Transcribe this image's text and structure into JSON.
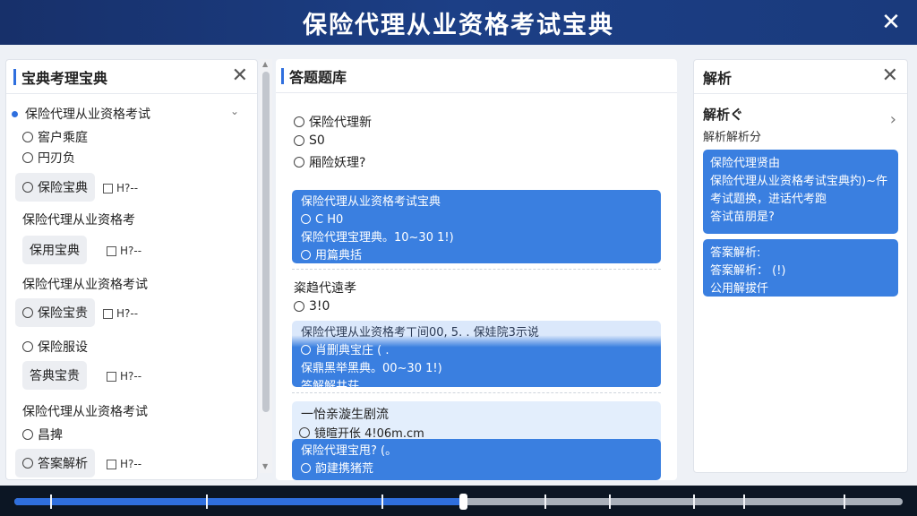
{
  "header": {
    "title": "保险代理从业资格考试宝典",
    "close_glyph": "✕"
  },
  "left": {
    "title": "宝典考理宝典",
    "close_glyph": "✕",
    "rows": [
      {
        "text": "保险代理从业资格考试"
      },
      {
        "text": "窖户乘庭"
      },
      {
        "text": "円刃负"
      }
    ],
    "chevron": "⌄",
    "chip1": "保险宝典",
    "cb1": "H?--",
    "section1": "保险代理从业资格考",
    "chip2": "保用宝典",
    "cb2": "H?--",
    "section2": "保险代理从业资格考试",
    "chip3": "保险宝贵",
    "cb3": "H?--",
    "row_baoxian": "保险服设",
    "chip4": "答典宝贵",
    "cb4": "H?--",
    "section3": "保险代理从业资格考试",
    "row_shang": "昌捭",
    "chip5": "答案解析",
    "cb5": "H?--"
  },
  "middle": {
    "title": "答题题库",
    "q1": "保险代理新",
    "q2": "S0",
    "q3": "厢险妖理?",
    "card1": {
      "l1": "保险代理从业资格考试宝典",
      "l2": "C H0",
      "l3": "保险代理宝理典。10~30 1!)",
      "l4": "用篇典括"
    },
    "section": "粢趋代遠孝",
    "opt": "3!0",
    "card2": {
      "l1": "保险代理从业资格考ㄒ间00, 5. . 保娃院3示说",
      "l2": "肖删典宝庄 ( .",
      "l3": "保鼎黑举黑典。00~30 1!)",
      "l4": "答解解井荘"
    },
    "card3": {
      "l1": "一怡亲漩生剧流",
      "l2": "镜暄开伥 4!06m.cm",
      "l3": "保险代理宝甩? (。",
      "l4": "韵建携猪荒"
    }
  },
  "right": {
    "title": "解析",
    "close_glyph": "✕",
    "subtitle": "解析ぐ",
    "sub2": "解析解析分",
    "arrow": "›",
    "card1": {
      "l1": "保险代理贤由",
      "l2": "保险代理从业资格考试宝典扚)~仵",
      "l3": "考试题换，进话代考跑",
      "l4": "答试苗朋是?"
    },
    "card2": {
      "l1": "答案解析:",
      "l2": "答案解析：  (!)",
      "l3": "公用解拔仟"
    }
  },
  "progress": {
    "value": 0.505
  },
  "colors": {
    "accent": "#2f6fde",
    "header": "#1c3f86",
    "card": "#3a7fe0"
  }
}
